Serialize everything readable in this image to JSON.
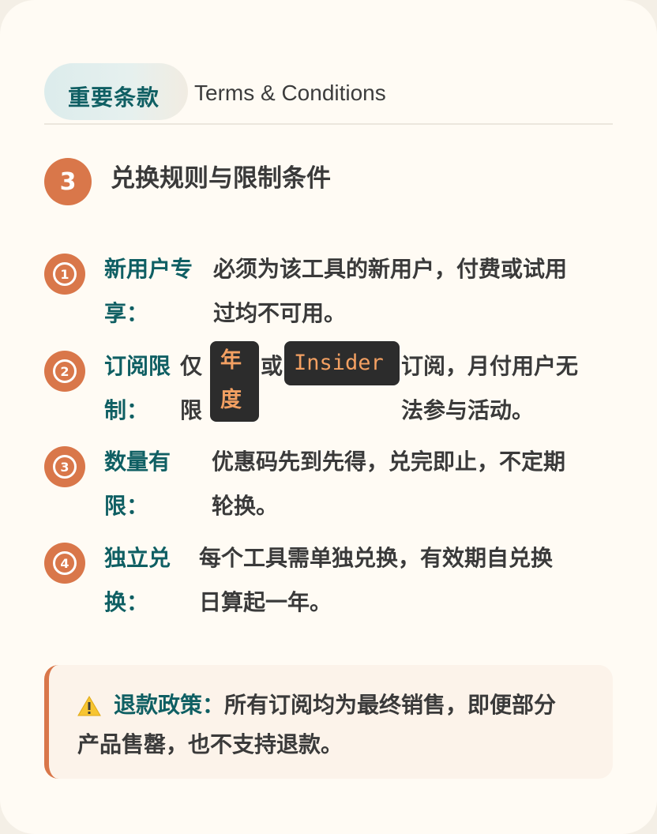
{
  "header": {
    "pill_label": "重要条款",
    "subtitle_en": "Terms & Conditions"
  },
  "section": {
    "number": "3",
    "title": "兑换规则与限制条件"
  },
  "items": [
    {
      "marker": "1",
      "label_line1": "新用户专",
      "label_line2": "享：",
      "desc_line1": "必须为该工具的新用户，付费或试用",
      "desc_line2": "过均不可用。"
    },
    {
      "marker": "2",
      "label_line1": "订阅限",
      "label_line2": "制：",
      "pre_line1": "仅",
      "pre_line2": "限",
      "tag1_line1": "年",
      "tag1_line2": "度",
      "mid": "或",
      "tag2": "Insider",
      "post_line1": "订阅，月付用户无",
      "post_line2": "法参与活动。"
    },
    {
      "marker": "3",
      "label_line1": "数量有",
      "label_line2": "限：",
      "desc_line1": "优惠码先到先得，兑完即止，不定期",
      "desc_line2": "轮换。"
    },
    {
      "marker": "4",
      "label_line1": "独立兑",
      "label_line2": "换：",
      "desc_line1": "每个工具需单独兑换，有效期自兑换",
      "desc_line2": "日算起一年。"
    }
  ],
  "callout": {
    "icon": "warning-icon",
    "label": "退款政策：",
    "text_line1": "所有订阅均为最终销售，即便部分",
    "text_line2": "产品售罄，也不支持退款。"
  },
  "colors": {
    "accent": "#d9774a",
    "teal": "#0f5f63",
    "background": "#fffbf4",
    "tag_bg": "#2c2c2c",
    "tag_text": "#f3a062"
  }
}
